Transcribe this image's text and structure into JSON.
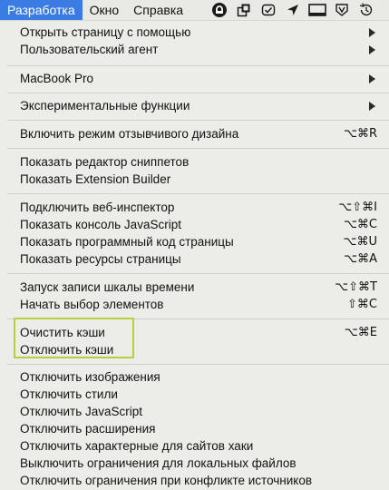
{
  "menubar": {
    "items": [
      "Разработка",
      "Окно",
      "Справка"
    ],
    "status_icons": [
      "lock-shield-icon",
      "layers-icon",
      "checkmark-badge-icon",
      "location-arrow-icon",
      "display-icon",
      "vpn-shield-icon",
      "time-machine-icon"
    ]
  },
  "menu": {
    "items": [
      {
        "label": "Открыть страницу с помощью",
        "shortcut": "",
        "submenu": true
      },
      {
        "label": "Пользовательский агент",
        "shortcut": "",
        "submenu": true
      },
      {
        "label": "MacBook Pro",
        "shortcut": "",
        "submenu": true
      },
      {
        "label": "Экспериментальные функции",
        "shortcut": "",
        "submenu": true
      },
      {
        "label": "Включить режим отзывчивого дизайна",
        "shortcut": "⌥⌘R",
        "submenu": false
      },
      {
        "label": "Показать редактор сниппетов",
        "shortcut": "",
        "submenu": false
      },
      {
        "label": "Показать Extension Builder",
        "shortcut": "",
        "submenu": false
      },
      {
        "label": "Подключить веб-инспектор",
        "shortcut": "⌥⇧⌘I",
        "submenu": false
      },
      {
        "label": "Показать консоль JavaScript",
        "shortcut": "⌥⌘C",
        "submenu": false
      },
      {
        "label": "Показать программный код страницы",
        "shortcut": "⌥⌘U",
        "submenu": false
      },
      {
        "label": "Показать ресурсы страницы",
        "shortcut": "⌥⌘A",
        "submenu": false
      },
      {
        "label": "Запуск записи шкалы времени",
        "shortcut": "⌥⇧⌘T",
        "submenu": false
      },
      {
        "label": "Начать выбор элементов",
        "shortcut": "⇧⌘C",
        "submenu": false
      },
      {
        "label": "Очистить кэши",
        "shortcut": "⌥⌘E",
        "submenu": false
      },
      {
        "label": "Отключить кэши",
        "shortcut": "",
        "submenu": false
      },
      {
        "label": "Отключить изображения",
        "shortcut": "",
        "submenu": false
      },
      {
        "label": "Отключить стили",
        "shortcut": "",
        "submenu": false
      },
      {
        "label": "Отключить JavaScript",
        "shortcut": "",
        "submenu": false
      },
      {
        "label": "Отключить расширения",
        "shortcut": "",
        "submenu": false
      },
      {
        "label": "Отключить характерные для сайтов хаки",
        "shortcut": "",
        "submenu": false
      },
      {
        "label": "Выключить ограничения для локальных файлов",
        "shortcut": "",
        "submenu": false
      },
      {
        "label": "Отключить ограничения при конфликте источников",
        "shortcut": "",
        "submenu": false
      }
    ]
  },
  "colors": {
    "menubar_active": "#3b7ce4",
    "menu_background": "#ecece9",
    "highlight_outline": "#b8cf3a"
  }
}
